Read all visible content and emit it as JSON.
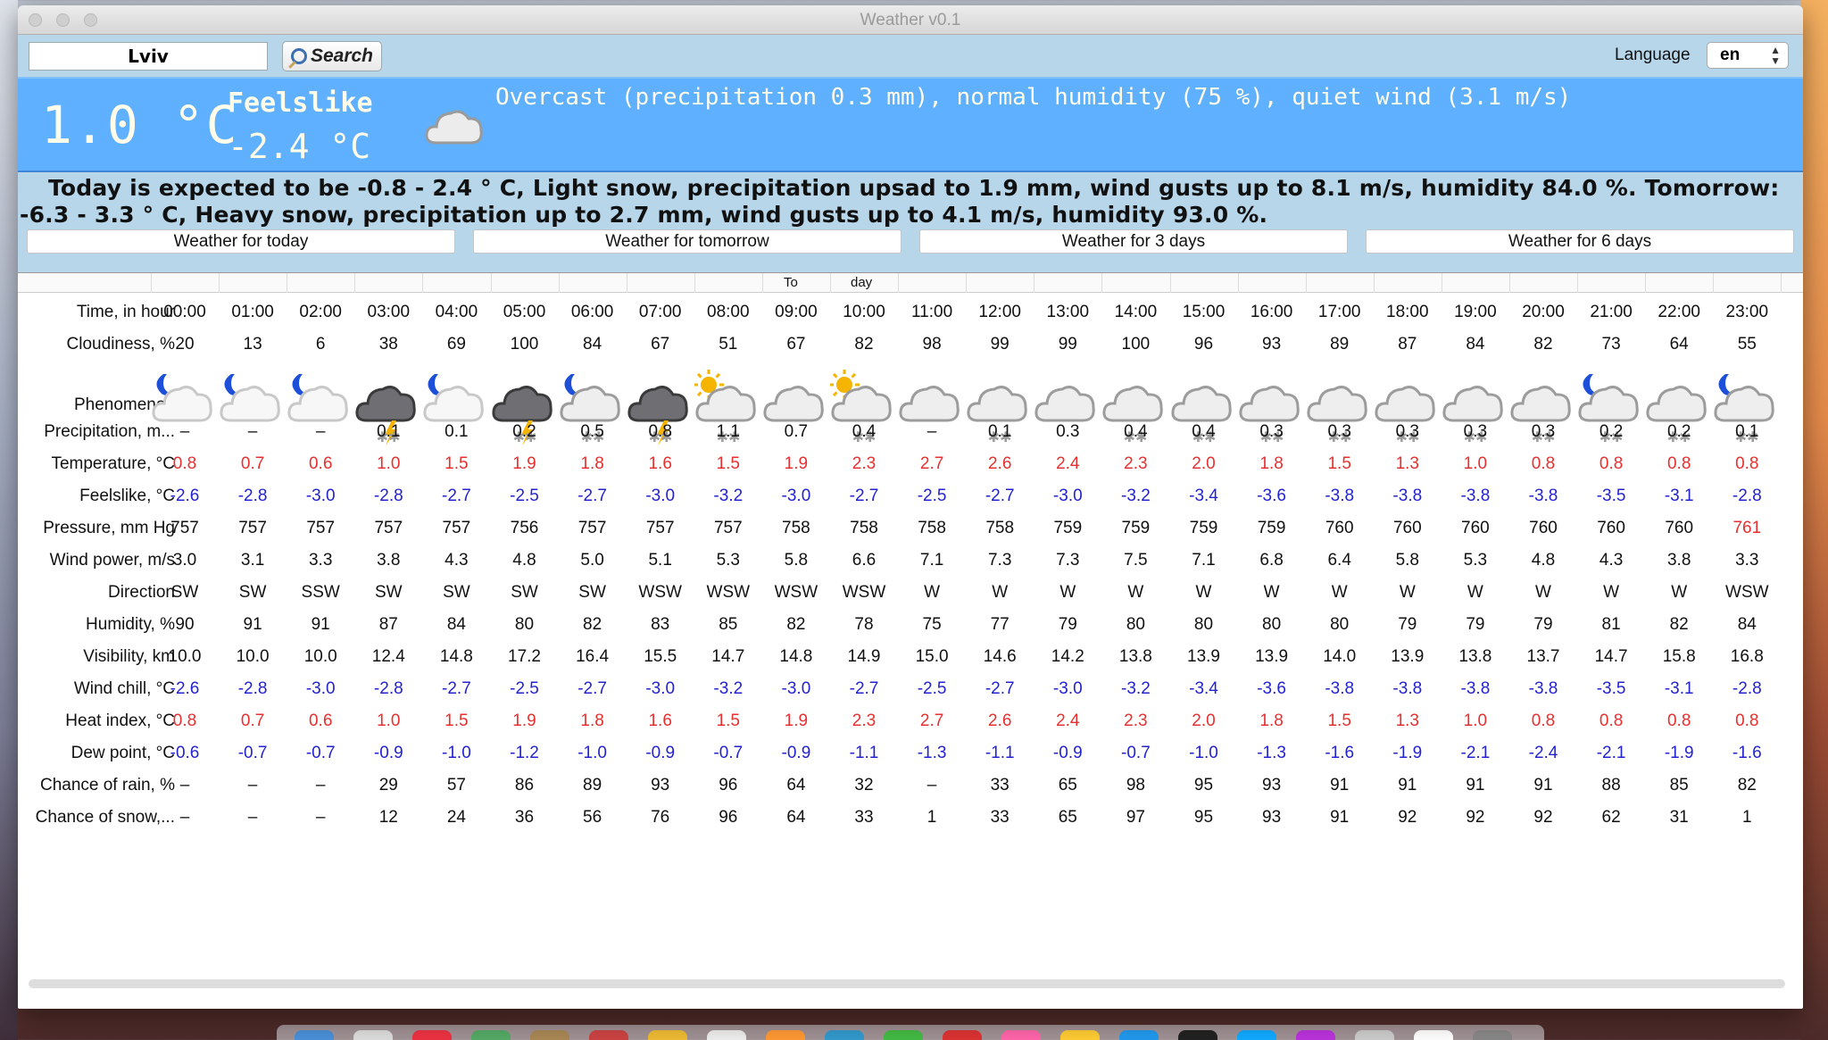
{
  "window": {
    "title": "Weather v0.1"
  },
  "toolbar": {
    "city": "Lviv",
    "search_label": "Search",
    "language_label": "Language",
    "language_value": "en"
  },
  "current": {
    "temperature": "1.0 °C",
    "feelslike_label": "Feelslike",
    "feelslike_value": "-2.4 °C",
    "condition": "Overcast (precipitation 0.3 mm), normal humidity (75 %), quiet wind (3.1 m/s)",
    "icon": "cloud-icon"
  },
  "summary": "Today is expected to be -0.8 - 2.4 ° C, Light snow, precipitation upsad to 1.9 mm, wind gusts up to 8.1 m/s, humidity 84.0 %. Tomorrow: -6.3 - 3.3 ° C, Heavy snow, precipitation up to 2.7 mm, wind gusts up to 4.1 m/s, humidity 93.0 %.",
  "tabs": [
    "Weather for today",
    "Weather for tomorrow",
    "Weather for 3 days",
    "Weather for 6 days"
  ],
  "table_header": {
    "part1": "To",
    "part2": "day"
  },
  "table": {
    "rows": [
      {
        "label": "Time, in hour",
        "color": "black",
        "values": [
          "00:00",
          "01:00",
          "02:00",
          "03:00",
          "04:00",
          "05:00",
          "06:00",
          "07:00",
          "08:00",
          "09:00",
          "10:00",
          "11:00",
          "12:00",
          "13:00",
          "14:00",
          "15:00",
          "16:00",
          "17:00",
          "18:00",
          "19:00",
          "20:00",
          "21:00",
          "22:00",
          "23:00"
        ]
      },
      {
        "label": "Cloudiness, %",
        "color": "black",
        "values": [
          "20",
          "13",
          "6",
          "38",
          "69",
          "100",
          "84",
          "67",
          "51",
          "67",
          "82",
          "98",
          "99",
          "99",
          "100",
          "96",
          "93",
          "89",
          "87",
          "84",
          "82",
          "73",
          "64",
          "55"
        ]
      },
      {
        "label": "Phenomenon",
        "color": "icons",
        "values": [
          "moon-cloud",
          "moon-cloud",
          "moon-cloud",
          "thunder-snow",
          "moon-cloud",
          "thunder-snow",
          "moon-cloud-snow",
          "thunder-snow",
          "sun-cloud-snow",
          "cloud",
          "sun-cloud-snow",
          "cloud",
          "cloud-snow",
          "cloud",
          "cloud-snow",
          "cloud-snow",
          "cloud-snow",
          "cloud-snow",
          "cloud-snow",
          "cloud-snow",
          "cloud-snow",
          "moon-cloud-snow",
          "cloud-snow",
          "moon-cloud-snow"
        ]
      },
      {
        "label": "Precipitation, m...",
        "color": "black",
        "values": [
          "–",
          "–",
          "–",
          "0.1",
          "0.1",
          "0.2",
          "0.5",
          "0.8",
          "1.1",
          "0.7",
          "0.4",
          "–",
          "0.1",
          "0.3",
          "0.4",
          "0.4",
          "0.3",
          "0.3",
          "0.3",
          "0.3",
          "0.3",
          "0.2",
          "0.2",
          "0.1"
        ]
      },
      {
        "label": "Temperature, °C",
        "color": "red",
        "values": [
          "0.8",
          "0.7",
          "0.6",
          "1.0",
          "1.5",
          "1.9",
          "1.8",
          "1.6",
          "1.5",
          "1.9",
          "2.3",
          "2.7",
          "2.6",
          "2.4",
          "2.3",
          "2.0",
          "1.8",
          "1.5",
          "1.3",
          "1.0",
          "0.8",
          "0.8",
          "0.8",
          "0.8"
        ]
      },
      {
        "label": "Feelslike, °C",
        "color": "blue",
        "values": [
          "-2.6",
          "-2.8",
          "-3.0",
          "-2.8",
          "-2.7",
          "-2.5",
          "-2.7",
          "-3.0",
          "-3.2",
          "-3.0",
          "-2.7",
          "-2.5",
          "-2.7",
          "-3.0",
          "-3.2",
          "-3.4",
          "-3.6",
          "-3.8",
          "-3.8",
          "-3.8",
          "-3.8",
          "-3.5",
          "-3.1",
          "-2.8"
        ]
      },
      {
        "label": "Pressure, mm Hg",
        "color": "black",
        "values": [
          "757",
          "757",
          "757",
          "757",
          "757",
          "756",
          "757",
          "757",
          "757",
          "758",
          "758",
          "758",
          "758",
          "759",
          "759",
          "759",
          "759",
          "760",
          "760",
          "760",
          "760",
          "760",
          "760",
          "761"
        ]
      },
      {
        "label": "Wind power, m/s",
        "color": "black",
        "values": [
          "3.0",
          "3.1",
          "3.3",
          "3.8",
          "4.3",
          "4.8",
          "5.0",
          "5.1",
          "5.3",
          "5.8",
          "6.6",
          "7.1",
          "7.3",
          "7.3",
          "7.5",
          "7.1",
          "6.8",
          "6.4",
          "5.8",
          "5.3",
          "4.8",
          "4.3",
          "3.8",
          "3.3"
        ]
      },
      {
        "label": "Direction",
        "color": "black",
        "values": [
          "SW",
          "SW",
          "SSW",
          "SW",
          "SW",
          "SW",
          "SW",
          "WSW",
          "WSW",
          "WSW",
          "WSW",
          "W",
          "W",
          "W",
          "W",
          "W",
          "W",
          "W",
          "W",
          "W",
          "W",
          "W",
          "W",
          "WSW"
        ]
      },
      {
        "label": "Humidity, %",
        "color": "black",
        "values": [
          "90",
          "91",
          "91",
          "87",
          "84",
          "80",
          "82",
          "83",
          "85",
          "82",
          "78",
          "75",
          "77",
          "79",
          "80",
          "80",
          "80",
          "80",
          "79",
          "79",
          "79",
          "81",
          "82",
          "84"
        ]
      },
      {
        "label": "Visibility, km",
        "color": "black",
        "values": [
          "10.0",
          "10.0",
          "10.0",
          "12.4",
          "14.8",
          "17.2",
          "16.4",
          "15.5",
          "14.7",
          "14.8",
          "14.9",
          "15.0",
          "14.6",
          "14.2",
          "13.8",
          "13.9",
          "13.9",
          "14.0",
          "13.9",
          "13.8",
          "13.7",
          "14.7",
          "15.8",
          "16.8"
        ]
      },
      {
        "label": "Wind chill, °C",
        "color": "blue",
        "values": [
          "-2.6",
          "-2.8",
          "-3.0",
          "-2.8",
          "-2.7",
          "-2.5",
          "-2.7",
          "-3.0",
          "-3.2",
          "-3.0",
          "-2.7",
          "-2.5",
          "-2.7",
          "-3.0",
          "-3.2",
          "-3.4",
          "-3.6",
          "-3.8",
          "-3.8",
          "-3.8",
          "-3.8",
          "-3.5",
          "-3.1",
          "-2.8"
        ]
      },
      {
        "label": "Heat index, °C",
        "color": "red",
        "values": [
          "0.8",
          "0.7",
          "0.6",
          "1.0",
          "1.5",
          "1.9",
          "1.8",
          "1.6",
          "1.5",
          "1.9",
          "2.3",
          "2.7",
          "2.6",
          "2.4",
          "2.3",
          "2.0",
          "1.8",
          "1.5",
          "1.3",
          "1.0",
          "0.8",
          "0.8",
          "0.8",
          "0.8"
        ]
      },
      {
        "label": "Dew point, °C",
        "color": "blue",
        "values": [
          "-0.6",
          "-0.7",
          "-0.7",
          "-0.9",
          "-1.0",
          "-1.2",
          "-1.0",
          "-0.9",
          "-0.7",
          "-0.9",
          "-1.1",
          "-1.3",
          "-1.1",
          "-0.9",
          "-0.7",
          "-1.0",
          "-1.3",
          "-1.6",
          "-1.9",
          "-2.1",
          "-2.4",
          "-2.1",
          "-1.9",
          "-1.6"
        ]
      },
      {
        "label": "Chance of rain, %",
        "color": "black",
        "values": [
          "–",
          "–",
          "–",
          "29",
          "57",
          "86",
          "89",
          "93",
          "96",
          "64",
          "32",
          "–",
          "33",
          "65",
          "98",
          "95",
          "93",
          "91",
          "91",
          "91",
          "91",
          "88",
          "85",
          "82"
        ]
      },
      {
        "label": "Chance of snow,...",
        "color": "black",
        "values": [
          "–",
          "–",
          "–",
          "12",
          "24",
          "36",
          "56",
          "76",
          "96",
          "64",
          "33",
          "1",
          "33",
          "65",
          "97",
          "95",
          "93",
          "91",
          "92",
          "92",
          "92",
          "62",
          "31",
          "1"
        ]
      }
    ],
    "red_exceptions": [
      {
        "row": 6,
        "col": 23
      }
    ]
  }
}
